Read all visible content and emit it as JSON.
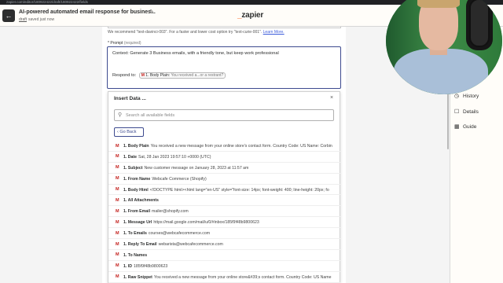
{
  "browser": {
    "url": "zapier.com/editor/180922422/draft/180922422/fields"
  },
  "header": {
    "title": "AI-powered automated email response for busines...",
    "status_badge": "draft",
    "status_text": "saved just now",
    "logo_prefix": "_",
    "logo_name": "zapier",
    "brand_color": "#ff4f00"
  },
  "form": {
    "hint_text": "We recommend \"text-davinci-003\". For a faster and lower cost option try \"text-curie-001\".",
    "hint_link": "Learn More.",
    "prompt_label": "* Prompt",
    "prompt_required": "(required)",
    "prompt_text": "Context: Generate 3 Business emails, with a friendly tone, but keep work professional",
    "respond_label": "Respond to:",
    "pill_prefix": "1. Body Plain:",
    "pill_value": "You received a...or a restrant?"
  },
  "insert": {
    "title": "Insert Data ...",
    "close": "×",
    "search_placeholder": "Search all available fields",
    "go_back": "Go Back",
    "rows": [
      {
        "label": "1. Body Plain",
        "value": "You received a new message from your online store's contact form. Country Code: US Name: Corbin"
      },
      {
        "label": "1. Date",
        "value": "Sat, 28 Jan 2023 19:57:10 +0000 (UTC)"
      },
      {
        "label": "1. Subject",
        "value": "New customer message on January 28, 2023 at 11:57 am"
      },
      {
        "label": "1. From Name",
        "value": "Webcafe Commerce (Shopify)"
      },
      {
        "label": "1. Body Html",
        "value": "<!DOCTYPE html><html lang=\"en-US\" style=\"font-size: 14px; font-weight: 400; line-height: 20px; fo"
      },
      {
        "label": "1. All Attachments",
        "value": ""
      },
      {
        "label": "1. From Email",
        "value": "mailer@shopify.com"
      },
      {
        "label": "1. Message Url",
        "value": "https://mail.google.com/mail/u/0/#inbox/185f9f48b9800623"
      },
      {
        "label": "1. To Emails",
        "value": "courses@webcafecommerce.com"
      },
      {
        "label": "1. Reply To Email",
        "value": "webarista@webcafecommerce.com"
      },
      {
        "label": "1. To Names",
        "value": ""
      },
      {
        "label": "1. ID",
        "value": "185f9f48b9800623"
      },
      {
        "label": "1. Raw Snippet",
        "value": "You received a new message from your online store&#39;s contact form. Country Code: US Name"
      }
    ]
  },
  "right_nav": {
    "items": [
      {
        "label": "sions",
        "icon": "versions-icon"
      },
      {
        "label": "History",
        "icon": "clock-icon"
      },
      {
        "label": "Details",
        "icon": "details-icon"
      },
      {
        "label": "Guide",
        "icon": "guide-icon"
      }
    ]
  }
}
